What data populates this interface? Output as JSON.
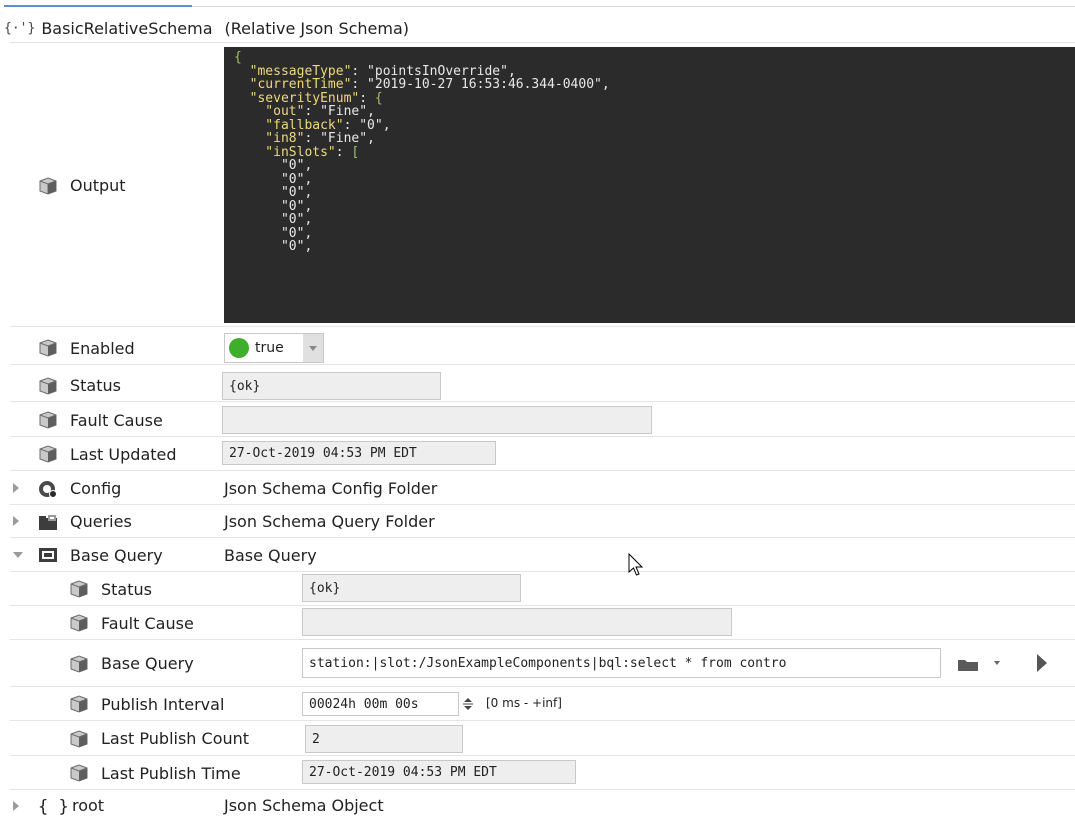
{
  "tab": {
    "active": true
  },
  "title": {
    "icon": "relative-json-schema-icon",
    "name": "BasicRelativeSchema",
    "type": "(Relative Json Schema)"
  },
  "output": {
    "label": "Output",
    "code_lines": [
      {
        "parts": [
          {
            "t": "{",
            "c": "p"
          }
        ]
      },
      {
        "parts": [
          {
            "t": "  \"messageType\"",
            "c": "k"
          },
          {
            "t": ": \"pointsInOverride\",",
            "c": "s"
          }
        ]
      },
      {
        "parts": [
          {
            "t": "  \"currentTime\"",
            "c": "k"
          },
          {
            "t": ": \"2019-10-27 16:53:46.344-0400\",",
            "c": "s"
          }
        ]
      },
      {
        "parts": [
          {
            "t": "  \"severityEnum\"",
            "c": "k"
          },
          {
            "t": ": ",
            "c": "s"
          },
          {
            "t": "{",
            "c": "p"
          }
        ]
      },
      {
        "parts": [
          {
            "t": "    \"out\"",
            "c": "k"
          },
          {
            "t": ": \"Fine\",",
            "c": "s"
          }
        ]
      },
      {
        "parts": [
          {
            "t": "    \"fallback\"",
            "c": "k"
          },
          {
            "t": ": \"0\",",
            "c": "s"
          }
        ]
      },
      {
        "parts": [
          {
            "t": "    \"in8\"",
            "c": "k"
          },
          {
            "t": ": \"Fine\",",
            "c": "s"
          }
        ]
      },
      {
        "parts": [
          {
            "t": "    \"inSlots\"",
            "c": "k"
          },
          {
            "t": ": ",
            "c": "s"
          },
          {
            "t": "[",
            "c": "p"
          }
        ]
      },
      {
        "parts": [
          {
            "t": "      \"0\",",
            "c": "s"
          }
        ]
      },
      {
        "parts": [
          {
            "t": "      \"0\",",
            "c": "s"
          }
        ]
      },
      {
        "parts": [
          {
            "t": "      \"0\",",
            "c": "s"
          }
        ]
      },
      {
        "parts": [
          {
            "t": "      \"0\",",
            "c": "s"
          }
        ]
      },
      {
        "parts": [
          {
            "t": "      \"0\",",
            "c": "s"
          }
        ]
      },
      {
        "parts": [
          {
            "t": "      \"0\",",
            "c": "s"
          }
        ]
      },
      {
        "parts": [
          {
            "t": "      \"0\",",
            "c": "s"
          }
        ]
      }
    ]
  },
  "enabled": {
    "label": "Enabled",
    "value": "true"
  },
  "status": {
    "label": "Status",
    "value": "{ok}"
  },
  "fault_cause": {
    "label": "Fault Cause",
    "value": ""
  },
  "last_updated": {
    "label": "Last Updated",
    "value": "27-Oct-2019 04:53 PM EDT"
  },
  "config": {
    "label": "Config",
    "value": "Json Schema Config Folder"
  },
  "queries": {
    "label": "Queries",
    "value": "Json Schema Query Folder"
  },
  "base_query": {
    "label": "Base Query",
    "value": "Base Query",
    "children": {
      "status": {
        "label": "Status",
        "value": "{ok}"
      },
      "fault_cause": {
        "label": "Fault Cause",
        "value": ""
      },
      "base_query": {
        "label": "Base Query",
        "value": "station:|slot:/JsonExampleComponents|bql:select * from contro"
      },
      "publish_interval": {
        "label": "Publish Interval",
        "value": "00024h 00m 00s",
        "range": "[0 ms - +inf]"
      },
      "last_publish_count": {
        "label": "Last Publish Count",
        "value": "2"
      },
      "last_publish_time": {
        "label": "Last Publish Time",
        "value": "27-Oct-2019 04:53 PM EDT"
      }
    }
  },
  "root": {
    "label": "root",
    "value": "Json Schema Object"
  },
  "colors": {
    "code_bg": "#2b2b2b",
    "code_key": "#f0d97a",
    "code_punct": "#9fc26a",
    "enabled_dot": "#3fae2a"
  }
}
